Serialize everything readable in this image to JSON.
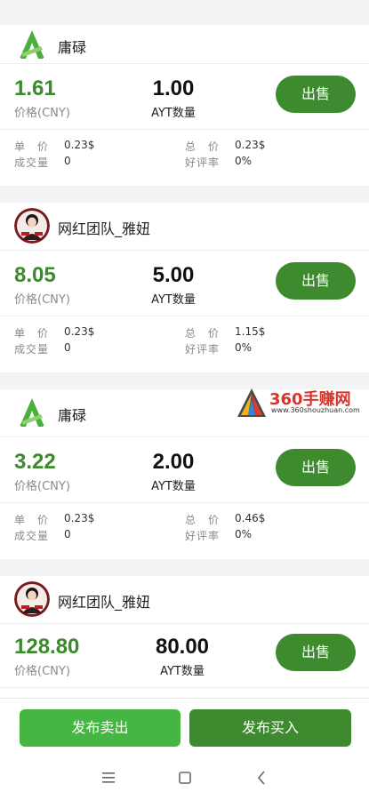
{
  "listings": [
    {
      "seller": "庸碌",
      "avatar_icon": "green-a-logo-icon",
      "price": "1.61",
      "price_label": "价格(CNY)",
      "quantity": "1.00",
      "quantity_label": "AYT数量",
      "action": "出售",
      "unit_price_label": "单　价",
      "unit_price": "0.23$",
      "total_label": "总　价",
      "total": "0.23$",
      "volume_label": "成交量",
      "volume": "0",
      "rating_label": "好评率",
      "rating": "0%"
    },
    {
      "seller": "网红团队_雅妞",
      "avatar_icon": "portrait-avatar",
      "price": "8.05",
      "price_label": "价格(CNY)",
      "quantity": "5.00",
      "quantity_label": "AYT数量",
      "action": "出售",
      "unit_price_label": "单　价",
      "unit_price": "0.23$",
      "total_label": "总　价",
      "total": "1.15$",
      "volume_label": "成交量",
      "volume": "0",
      "rating_label": "好评率",
      "rating": "0%"
    },
    {
      "seller": "庸碌",
      "avatar_icon": "green-a-logo-icon",
      "price": "3.22",
      "price_label": "价格(CNY)",
      "quantity": "2.00",
      "quantity_label": "AYT数量",
      "action": "出售",
      "unit_price_label": "单　价",
      "unit_price": "0.23$",
      "total_label": "总　价",
      "total": "0.46$",
      "volume_label": "成交量",
      "volume": "0",
      "rating_label": "好评率",
      "rating": "0%"
    },
    {
      "seller": "网红团队_雅妞",
      "avatar_icon": "portrait-avatar",
      "price": "128.80",
      "price_label": "价格(CNY)",
      "quantity": "80.00",
      "quantity_label": "AYT数量",
      "action": "出售"
    }
  ],
  "bottom_bar": {
    "publish_sell": "发布卖出",
    "publish_buy": "发布买入"
  },
  "watermark": {
    "brand": "360手赚网",
    "url": "www.360shouzhuan.com"
  },
  "colors": {
    "accent": "#3d8a2f",
    "price": "#3b8a2c",
    "publish_sell_bg": "#45b641",
    "publish_buy_bg": "#3e8a2e"
  },
  "system_nav": [
    "menu-icon",
    "home-icon",
    "back-icon"
  ]
}
